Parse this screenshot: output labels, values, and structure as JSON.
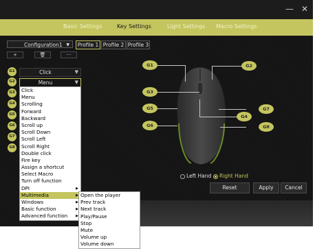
{
  "window": {
    "minimize": "—",
    "close": "✕"
  },
  "nav": {
    "tabs": [
      "Basic Settings",
      "Key Settings",
      "Light Settings",
      "Macro Settings"
    ],
    "active": "Key Settings"
  },
  "config": {
    "selected": "Configuration1",
    "profiles": [
      "Profile 1",
      "Profile 2",
      "Profile 3"
    ],
    "active_profile": "Profile 1"
  },
  "toolbar": {
    "add": "+",
    "delete": "🗑",
    "more": "···"
  },
  "buttons": [
    {
      "id": "G1",
      "value": "Click"
    },
    {
      "id": "G2",
      "value": "Menu"
    },
    {
      "id": "G3"
    },
    {
      "id": "G4"
    },
    {
      "id": "G5"
    },
    {
      "id": "G6"
    },
    {
      "id": "G7"
    },
    {
      "id": "G8"
    }
  ],
  "dropdown": {
    "items": [
      "Click",
      "Menu",
      "Scrolling",
      "Forward",
      "Backward",
      "Scroll up",
      "Scroll Down",
      "Scroll Left",
      "Scroll Right",
      "Double click",
      "Fire key",
      "Assign a shortcut",
      "Select Macro",
      "Turn off function",
      "DPI",
      "Multimedia",
      "Windows",
      "Basic function",
      "Advanced function"
    ],
    "submenu_flags": [
      false,
      false,
      false,
      false,
      false,
      false,
      false,
      false,
      false,
      false,
      false,
      false,
      false,
      false,
      true,
      true,
      true,
      true,
      true
    ],
    "highlighted": "Multimedia"
  },
  "submenu": {
    "items": [
      "Open the player",
      "Prev track",
      "Next  track",
      "Play/Pause",
      "Stop",
      "Mute",
      "Volume up",
      "Volume down"
    ]
  },
  "mouse_callouts": [
    "G1",
    "G2",
    "G3",
    "G4",
    "G5",
    "G6",
    "G7",
    "G8"
  ],
  "hand": {
    "left": "Left Hand",
    "right": "Right Hand",
    "selected": "Right Hand"
  },
  "actions": {
    "reset": "Reset",
    "apply": "Apply",
    "cancel": "Cancel"
  },
  "colors": {
    "accent": "#c4c55f",
    "background": "#141414"
  }
}
